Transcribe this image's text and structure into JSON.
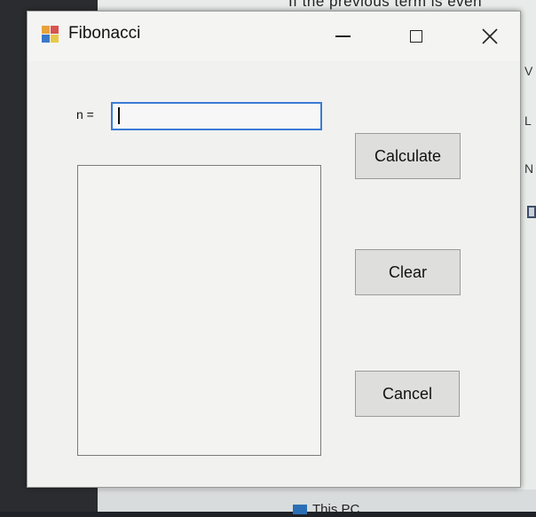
{
  "background": {
    "top_text": "If the previous term is even",
    "right_fragments": [
      "V",
      "L",
      "N"
    ],
    "taskbar_item": "This PC"
  },
  "window": {
    "title": "Fibonacci",
    "controls": {
      "minimize": "—",
      "maximize": "☐",
      "close": "✕"
    }
  },
  "form": {
    "n_label": "n =",
    "n_value": "",
    "output_text": "",
    "buttons": {
      "calculate": "Calculate",
      "clear": "Clear",
      "cancel": "Cancel"
    }
  },
  "colors": {
    "input_focus_border": "#3a7bd5",
    "button_face": "#dededd",
    "window_bg": "#f1f1f0"
  }
}
